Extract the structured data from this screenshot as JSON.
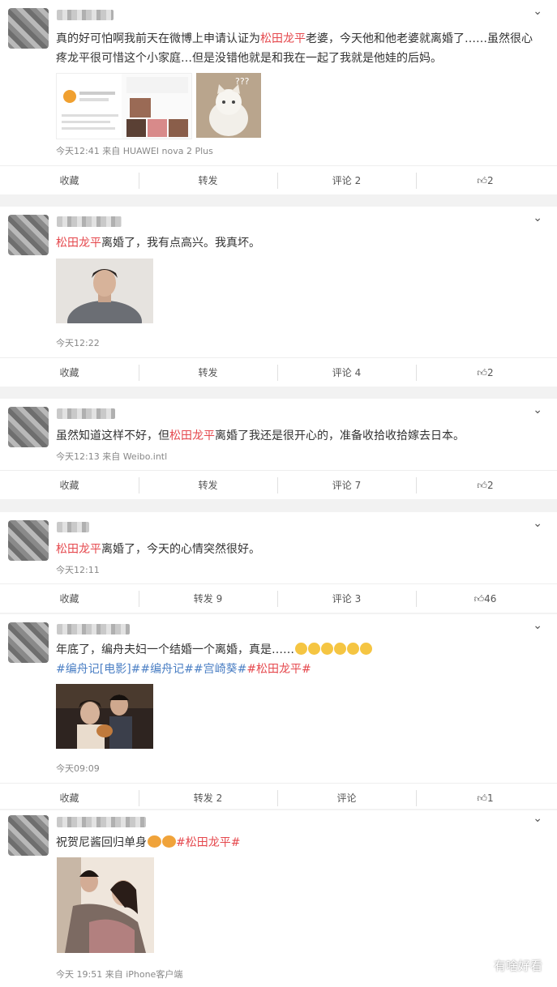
{
  "posts": [
    {
      "text_pre": "真的好可怕啊我前天在微博上申请认证为",
      "text_hl": "松田龙平",
      "text_post": "老婆，今天他和他老婆就离婚了……虽然很心疼龙平很可惜这个小家庭…但是没错他就是和我在一起了我就是他娃的后妈。",
      "meta": "今天12:41 来自 HUAWEI nova 2 Plus",
      "bar": {
        "fav": "收藏",
        "repost": "转发",
        "comment": "评论 2",
        "like": "2"
      }
    },
    {
      "text_hl": "松田龙平",
      "text_post": "离婚了，我有点高兴。我真坏。",
      "meta": "今天12:22",
      "bar": {
        "fav": "收藏",
        "repost": "转发",
        "comment": "评论 4",
        "like": "2"
      }
    },
    {
      "text_pre": "虽然知道这样不好，但",
      "text_hl": "松田龙平",
      "text_post": "离婚了我还是很开心的，准备收拾收拾嫁去日本。",
      "meta": "今天12:13 来自 Weibo.intl",
      "bar": {
        "fav": "收藏",
        "repost": "转发",
        "comment": "评论 7",
        "like": "2"
      }
    },
    {
      "text_hl": "松田龙平",
      "text_post": "离婚了，今天的心情突然很好。",
      "meta": "今天12:11",
      "bar": {
        "fav": "收藏",
        "repost": "转发 9",
        "comment": "评论 3",
        "like": "46"
      }
    },
    {
      "text_pre": "年底了，编舟夫妇一个结婚一个离婚，真是……",
      "topics": [
        "#编舟记[电影]#",
        "#编舟记#",
        "#宫崎葵#",
        "#松田龙平#"
      ],
      "meta": "今天09:09",
      "bar": {
        "fav": "收藏",
        "repost": "转发 2",
        "comment": "评论",
        "like": "1"
      }
    },
    {
      "text_pre": "祝贺尼酱回归单身",
      "topic_hl": "#松田龙平#",
      "meta": "今天 19:51 来自 iPhone客户端"
    }
  ],
  "watermark": "有啥好看",
  "icons": [
    "chevron-down-icon",
    "thumbs-up-icon",
    "wechat-logo-icon"
  ]
}
